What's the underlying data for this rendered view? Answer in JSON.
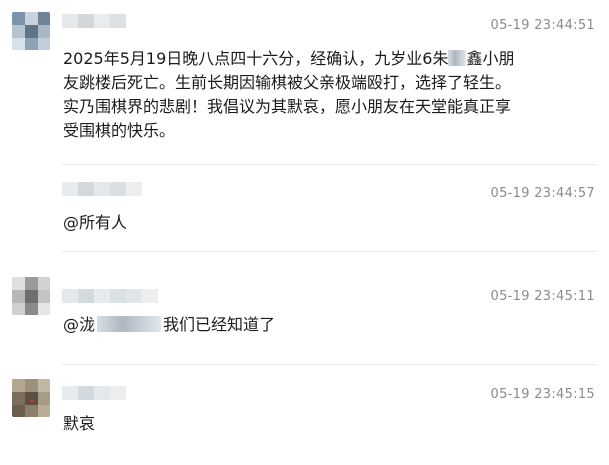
{
  "messages": [
    {
      "time": "05-19 23:44:51",
      "lines": [
        "2025年5月19日晚八点四十六分，经确认，九岁业6朱",
        "鑫小朋",
        "友跳楼后死亡。生前长期因输棋被父亲极端殴打，选择了轻生。",
        "实乃围棋界的悲剧！我倡议为其默哀，愿小朋友在天堂能真正享",
        "受围棋的快乐。"
      ]
    },
    {
      "time": "05-19 23:44:57",
      "text": "@所有人"
    },
    {
      "time": "05-19 23:45:11",
      "prefix": "@泷",
      "suffix": "我们已经知道了"
    },
    {
      "time": "05-19 23:45:15",
      "text": "默哀"
    }
  ]
}
